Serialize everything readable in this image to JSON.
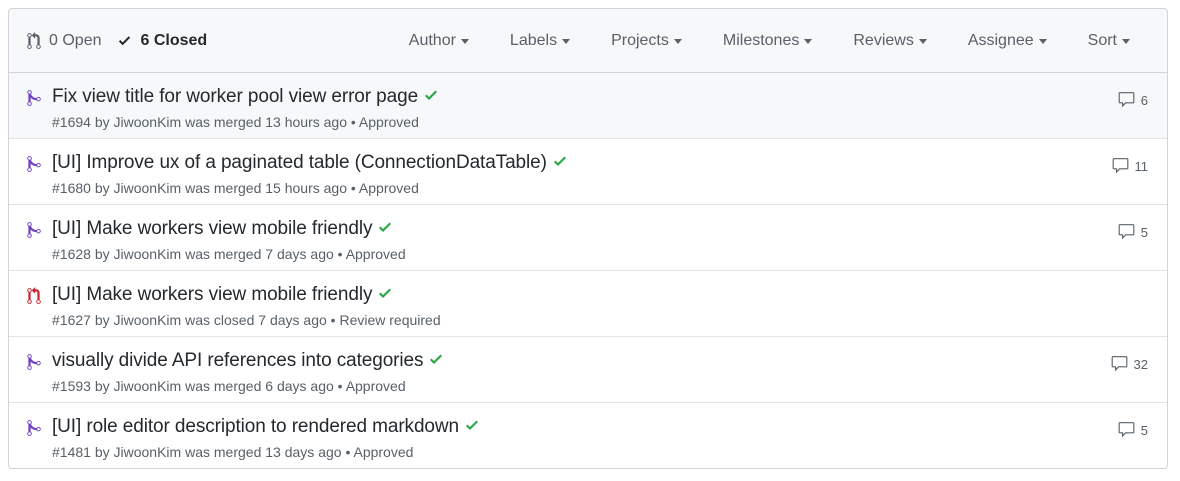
{
  "header": {
    "open_label": "0 Open",
    "closed_label": "6 Closed",
    "filters": [
      "Author",
      "Labels",
      "Projects",
      "Milestones",
      "Reviews",
      "Assignee",
      "Sort"
    ]
  },
  "pull_requests": [
    {
      "title": "Fix view title for worker pool view error page",
      "number": "#1694",
      "author": "JiwoonKim",
      "action": "was merged",
      "time": "13 hours ago",
      "review": "Approved",
      "comments": "6",
      "state": "merged"
    },
    {
      "title": "[UI] Improve ux of a paginated table (ConnectionDataTable)",
      "number": "#1680",
      "author": "JiwoonKim",
      "action": "was merged",
      "time": "15 hours ago",
      "review": "Approved",
      "comments": "11",
      "state": "merged"
    },
    {
      "title": "[UI] Make workers view mobile friendly",
      "number": "#1628",
      "author": "JiwoonKim",
      "action": "was merged",
      "time": "7 days ago",
      "review": "Approved",
      "comments": "5",
      "state": "merged"
    },
    {
      "title": "[UI] Make workers view mobile friendly",
      "number": "#1627",
      "author": "JiwoonKim",
      "action": "was closed",
      "time": "7 days ago",
      "review": "Review required",
      "comments": "",
      "state": "closed"
    },
    {
      "title": "visually divide API references into categories",
      "number": "#1593",
      "author": "JiwoonKim",
      "action": "was merged",
      "time": "6 days ago",
      "review": "Approved",
      "comments": "32",
      "state": "merged"
    },
    {
      "title": "[UI] role editor description to rendered markdown",
      "number": "#1481",
      "author": "JiwoonKim",
      "action": "was merged",
      "time": "13 days ago",
      "review": "Approved",
      "comments": "5",
      "state": "merged"
    }
  ],
  "icons": {
    "merged": "git-merge-icon",
    "closed": "git-pull-request-closed-icon",
    "check": "check-icon",
    "comment": "comment-icon"
  },
  "colors": {
    "merged": "#6f42c1",
    "closed": "#cb2431",
    "success": "#28a745"
  }
}
